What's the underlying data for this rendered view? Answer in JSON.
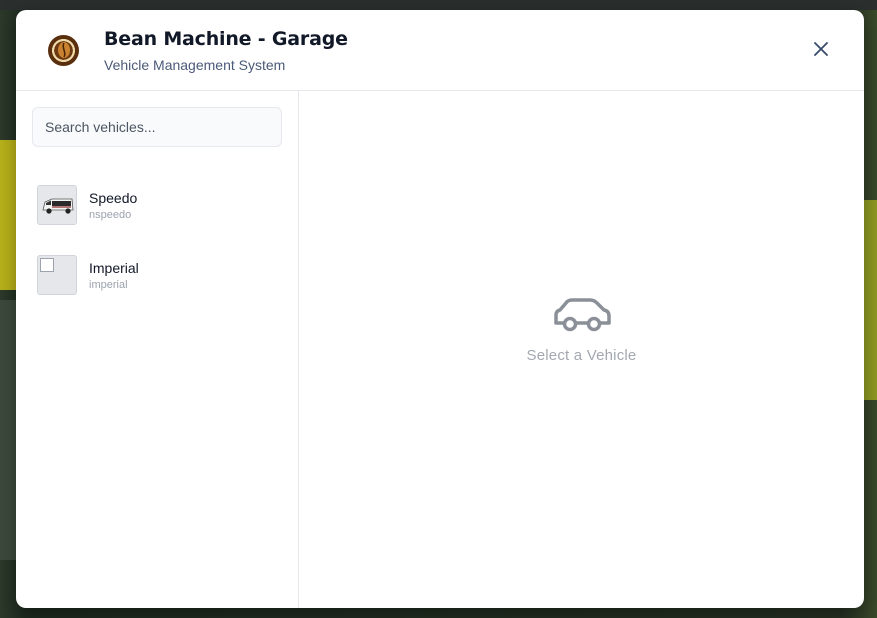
{
  "header": {
    "title": "Bean Machine - Garage",
    "subtitle": "Vehicle Management System",
    "logo_icon": "coffee-bean-logo-icon",
    "close_icon": "close-icon"
  },
  "search": {
    "placeholder": "Search vehicles..."
  },
  "vehicles": [
    {
      "name": "Speedo",
      "model": "nspeedo",
      "thumbnail": "van-image"
    },
    {
      "name": "Imperial",
      "model": "imperial",
      "thumbnail": "broken-image"
    }
  ],
  "empty_state": {
    "icon": "car-icon",
    "text": "Select a Vehicle"
  },
  "colors": {
    "title": "#111827",
    "subtitle": "#4b5a78",
    "muted": "#a3a8b0",
    "border": "#e6e8ec"
  }
}
